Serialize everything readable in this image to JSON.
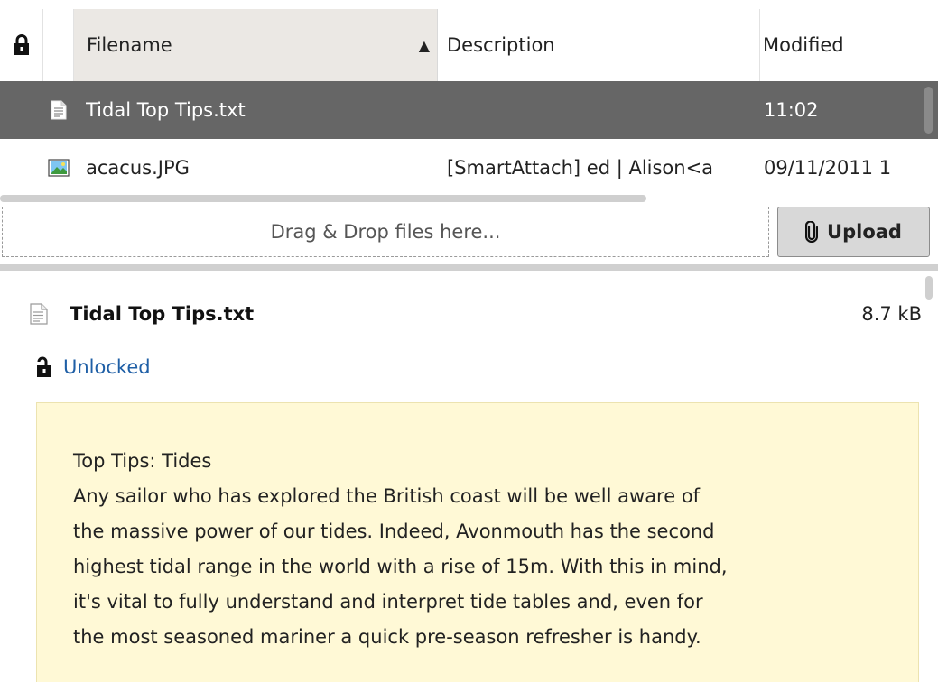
{
  "columns": {
    "lock_icon": "lock-icon",
    "filename": "Filename",
    "sort_indicator": "▲",
    "description": "Description",
    "modified": "Modified"
  },
  "files": [
    {
      "icon": "text-file-icon",
      "name": "Tidal Top Tips.txt",
      "description": "",
      "modified": "11:02",
      "selected": true
    },
    {
      "icon": "image-file-icon",
      "name": "acacus.JPG",
      "description": "[SmartAttach] ed | Alison<a",
      "modified": "09/11/2011 1",
      "selected": false
    }
  ],
  "upload": {
    "dropzone_label": "Drag & Drop files here...",
    "button_label": "Upload",
    "button_icon": "paperclip-icon"
  },
  "preview": {
    "file_icon": "text-file-icon",
    "filename": "Tidal Top Tips.txt",
    "size": "8.7 kB",
    "lock_status": "Unlocked",
    "lock_icon": "unlocked-icon",
    "content_lines": [
      "Top Tips: Tides",
      "Any sailor who has explored the British coast will be well aware of",
      "the massive power of our tides. Indeed, Avonmouth has the second",
      "highest tidal range in the world with a rise of 15m. With this in mind,",
      "it's vital to fully understand and interpret tide tables and, even for",
      "the most seasoned mariner a quick pre-season refresher is handy."
    ]
  },
  "colors": {
    "selected_row": "#666666",
    "sorted_header": "#ebe8e4",
    "preview_note_bg": "#fff9d6",
    "link_blue": "#1f5fa6"
  }
}
